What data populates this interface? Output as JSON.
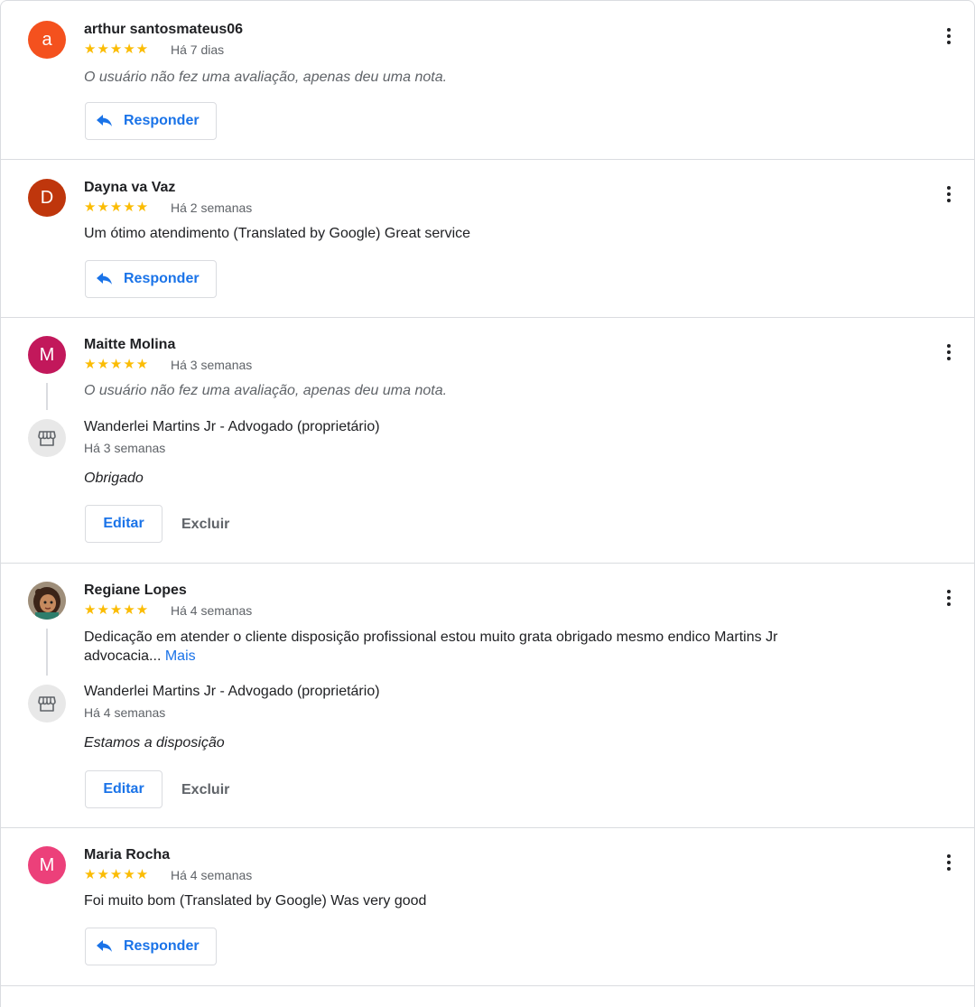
{
  "reviews": [
    {
      "initial": "a",
      "color": "#f4511e",
      "name": "arthur santosmateus06",
      "stars": "★★★★★",
      "date": "Há 7 dias",
      "text": "O usuário não fez uma avaliação, apenas deu uma nota.",
      "reply_label": "Responder"
    },
    {
      "initial": "D",
      "color": "#bf360c",
      "name": "Dayna va Vaz",
      "stars": "★★★★★",
      "date": "Há 2 semanas",
      "text": "Um ótimo atendimento (Translated by Google) Great service",
      "reply_label": "Responder"
    },
    {
      "initial": "M",
      "color": "#c2185b",
      "name": "Maitte Molina",
      "stars": "★★★★★",
      "date": "Há 3 semanas",
      "text": "O usuário não fez uma avaliação, apenas deu uma nota.",
      "owner_name": "Wanderlei Martins Jr - Advogado (proprietário)",
      "owner_date": "Há 3 semanas",
      "owner_reply": "Obrigado",
      "edit_label": "Editar",
      "delete_label": "Excluir"
    },
    {
      "photo_icon": "person-photo-icon",
      "name": "Regiane Lopes",
      "stars": "★★★★★",
      "date": "Há 4 semanas",
      "text_line1": "Dedicação em atender o cliente disposição profissional estou muito grata obrigado mesmo endico Martins Jr",
      "text_line2": "advocacia...",
      "more_label": "Mais",
      "owner_name": "Wanderlei Martins Jr - Advogado (proprietário)",
      "owner_date": "Há 4 semanas",
      "owner_reply": "Estamos a disposição",
      "edit_label": "Editar",
      "delete_label": "Excluir"
    },
    {
      "initial": "M",
      "color": "#ec407a",
      "name": "Maria Rocha",
      "stars": "★★★★★",
      "date": "Há 4 semanas",
      "text": "Foi muito bom (Translated by Google) Was very good",
      "reply_label": "Responder"
    }
  ]
}
